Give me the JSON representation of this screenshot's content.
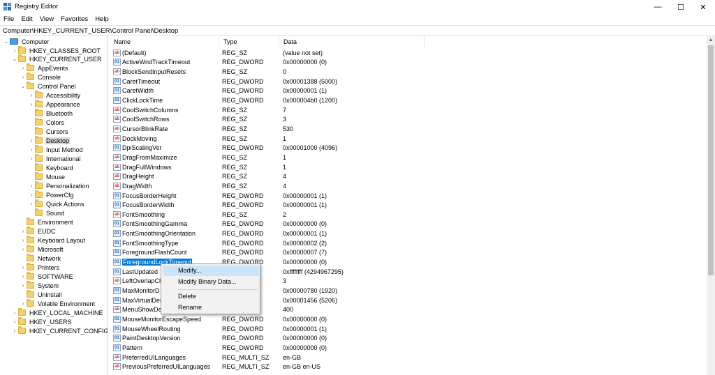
{
  "window": {
    "title": "Registry Editor",
    "minimize_glyph": "—",
    "maximize_glyph": "☐",
    "close_glyph": "✕"
  },
  "menu": [
    "File",
    "Edit",
    "View",
    "Favorites",
    "Help"
  ],
  "address": "Computer\\HKEY_CURRENT_USER\\Control Panel\\Desktop",
  "tree": [
    {
      "label": "Computer",
      "chevron": "⌄",
      "icon": "computer-icon"
    },
    {
      "label": "HKEY_CLASSES_ROOT",
      "chevron": "›",
      "icon": "folder-icon"
    },
    {
      "label": "HKEY_CURRENT_USER",
      "chevron": "⌄",
      "icon": "folder-icon"
    },
    {
      "label": "AppEvents",
      "chevron": "›",
      "icon": "folder-icon"
    },
    {
      "label": "Console",
      "chevron": "›",
      "icon": "folder-icon"
    },
    {
      "label": "Control Panel",
      "chevron": "⌄",
      "icon": "folder-icon"
    },
    {
      "label": "Accessibility",
      "chevron": "›",
      "icon": "folder-icon"
    },
    {
      "label": "Appearance",
      "chevron": "›",
      "icon": "folder-icon"
    },
    {
      "label": "Bluetooth",
      "chevron": "",
      "icon": "folder-icon"
    },
    {
      "label": "Colors",
      "chevron": "",
      "icon": "folder-icon"
    },
    {
      "label": "Cursors",
      "chevron": "",
      "icon": "folder-icon"
    },
    {
      "label": "Desktop",
      "chevron": "›",
      "icon": "folder-icon",
      "selected": true
    },
    {
      "label": "Input Method",
      "chevron": "›",
      "icon": "folder-icon"
    },
    {
      "label": "International",
      "chevron": "›",
      "icon": "folder-icon"
    },
    {
      "label": "Keyboard",
      "chevron": "",
      "icon": "folder-icon"
    },
    {
      "label": "Mouse",
      "chevron": "",
      "icon": "folder-icon"
    },
    {
      "label": "Personalization",
      "chevron": "›",
      "icon": "folder-icon"
    },
    {
      "label": "PowerCfg",
      "chevron": "›",
      "icon": "folder-icon"
    },
    {
      "label": "Quick Actions",
      "chevron": "›",
      "icon": "folder-icon"
    },
    {
      "label": "Sound",
      "chevron": "",
      "icon": "folder-icon"
    },
    {
      "label": "Environment",
      "chevron": "",
      "icon": "folder-icon"
    },
    {
      "label": "EUDC",
      "chevron": "›",
      "icon": "folder-icon"
    },
    {
      "label": "Keyboard Layout",
      "chevron": "›",
      "icon": "folder-icon"
    },
    {
      "label": "Microsoft",
      "chevron": "›",
      "icon": "folder-icon"
    },
    {
      "label": "Network",
      "chevron": "",
      "icon": "folder-icon"
    },
    {
      "label": "Printers",
      "chevron": "›",
      "icon": "folder-icon"
    },
    {
      "label": "SOFTWARE",
      "chevron": "›",
      "icon": "folder-icon"
    },
    {
      "label": "System",
      "chevron": "›",
      "icon": "folder-icon"
    },
    {
      "label": "Uninstall",
      "chevron": "",
      "icon": "folder-icon"
    },
    {
      "label": "Volatile Environment",
      "chevron": "›",
      "icon": "folder-icon"
    },
    {
      "label": "HKEY_LOCAL_MACHINE",
      "chevron": "›",
      "icon": "folder-icon"
    },
    {
      "label": "HKEY_USERS",
      "chevron": "›",
      "icon": "folder-icon"
    },
    {
      "label": "HKEY_CURRENT_CONFIG",
      "chevron": "›",
      "icon": "folder-icon"
    }
  ],
  "columns": {
    "name": "Name",
    "type": "Type",
    "data": "Data"
  },
  "values": [
    {
      "name": "(Default)",
      "type": "REG_SZ",
      "data": "(value not set)",
      "kind": "sz"
    },
    {
      "name": "ActiveWndTrackTimeout",
      "type": "REG_DWORD",
      "data": "0x00000000 (0)",
      "kind": "bin"
    },
    {
      "name": "BlockSendInputResets",
      "type": "REG_SZ",
      "data": "0",
      "kind": "sz"
    },
    {
      "name": "CaretTimeout",
      "type": "REG_DWORD",
      "data": "0x00001388 (5000)",
      "kind": "bin"
    },
    {
      "name": "CaretWidth",
      "type": "REG_DWORD",
      "data": "0x00000001 (1)",
      "kind": "bin"
    },
    {
      "name": "ClickLockTime",
      "type": "REG_DWORD",
      "data": "0x000004b0 (1200)",
      "kind": "bin"
    },
    {
      "name": "CoolSwitchColumns",
      "type": "REG_SZ",
      "data": "7",
      "kind": "sz"
    },
    {
      "name": "CoolSwitchRows",
      "type": "REG_SZ",
      "data": "3",
      "kind": "sz"
    },
    {
      "name": "CursorBlinkRate",
      "type": "REG_SZ",
      "data": "530",
      "kind": "sz"
    },
    {
      "name": "DockMoving",
      "type": "REG_SZ",
      "data": "1",
      "kind": "sz"
    },
    {
      "name": "DpiScalingVer",
      "type": "REG_DWORD",
      "data": "0x00001000 (4096)",
      "kind": "bin"
    },
    {
      "name": "DragFromMaximize",
      "type": "REG_SZ",
      "data": "1",
      "kind": "sz"
    },
    {
      "name": "DragFullWindows",
      "type": "REG_SZ",
      "data": "1",
      "kind": "sz"
    },
    {
      "name": "DragHeight",
      "type": "REG_SZ",
      "data": "4",
      "kind": "sz"
    },
    {
      "name": "DragWidth",
      "type": "REG_SZ",
      "data": "4",
      "kind": "sz"
    },
    {
      "name": "FocusBorderHeight",
      "type": "REG_DWORD",
      "data": "0x00000001 (1)",
      "kind": "bin"
    },
    {
      "name": "FocusBorderWidth",
      "type": "REG_DWORD",
      "data": "0x00000001 (1)",
      "kind": "bin"
    },
    {
      "name": "FontSmoothing",
      "type": "REG_SZ",
      "data": "2",
      "kind": "sz"
    },
    {
      "name": "FontSmoothingGamma",
      "type": "REG_DWORD",
      "data": "0x00000000 (0)",
      "kind": "bin"
    },
    {
      "name": "FontSmoothingOrientation",
      "type": "REG_DWORD",
      "data": "0x00000001 (1)",
      "kind": "bin"
    },
    {
      "name": "FontSmoothingType",
      "type": "REG_DWORD",
      "data": "0x00000002 (2)",
      "kind": "bin"
    },
    {
      "name": "ForegroundFlashCount",
      "type": "REG_DWORD",
      "data": "0x00000007 (7)",
      "kind": "bin"
    },
    {
      "name": "ForegroundLockTimeout",
      "type": "REG_DWORD",
      "data": "0x00000000 (0)",
      "kind": "bin",
      "selected": true
    },
    {
      "name": "LastUpdated",
      "type": "",
      "data": "0xffffffff (4294967295)",
      "kind": "bin"
    },
    {
      "name": "LeftOverlapCh",
      "type": "",
      "data": "3",
      "kind": "sz"
    },
    {
      "name": "MaxMonitorD",
      "type": "",
      "data": "0x00000780 (1920)",
      "kind": "bin"
    },
    {
      "name": "MaxVirtualDes",
      "type": "",
      "data": "0x00001456 (5206)",
      "kind": "bin"
    },
    {
      "name": "MenuShowDe",
      "type": "",
      "data": "400",
      "kind": "sz"
    },
    {
      "name": "MouseMonitorEscapeSpeed",
      "type": "REG_DWORD",
      "data": "0x00000000 (0)",
      "kind": "bin"
    },
    {
      "name": "MouseWheelRouting",
      "type": "REG_DWORD",
      "data": "0x00000001 (1)",
      "kind": "bin"
    },
    {
      "name": "PaintDesktopVersion",
      "type": "REG_DWORD",
      "data": "0x00000000 (0)",
      "kind": "bin"
    },
    {
      "name": "Pattern",
      "type": "REG_DWORD",
      "data": "0x00000000 (0)",
      "kind": "bin"
    },
    {
      "name": "PreferredUILanguages",
      "type": "REG_MULTI_SZ",
      "data": "en-GB",
      "kind": "sz"
    },
    {
      "name": "PreviousPreferredUILanguages",
      "type": "REG_MULTI_SZ",
      "data": "en-GB en-US",
      "kind": "sz"
    }
  ],
  "icon_text": {
    "sz": "ab",
    "bin": "01"
  },
  "context_menu": {
    "modify": "Modify...",
    "modify_binary": "Modify Binary Data...",
    "delete": "Delete",
    "rename": "Rename"
  },
  "colors": {
    "selection": "#0078d7",
    "menu_highlight": "#cce4f7",
    "folder": "#f4d26b"
  }
}
